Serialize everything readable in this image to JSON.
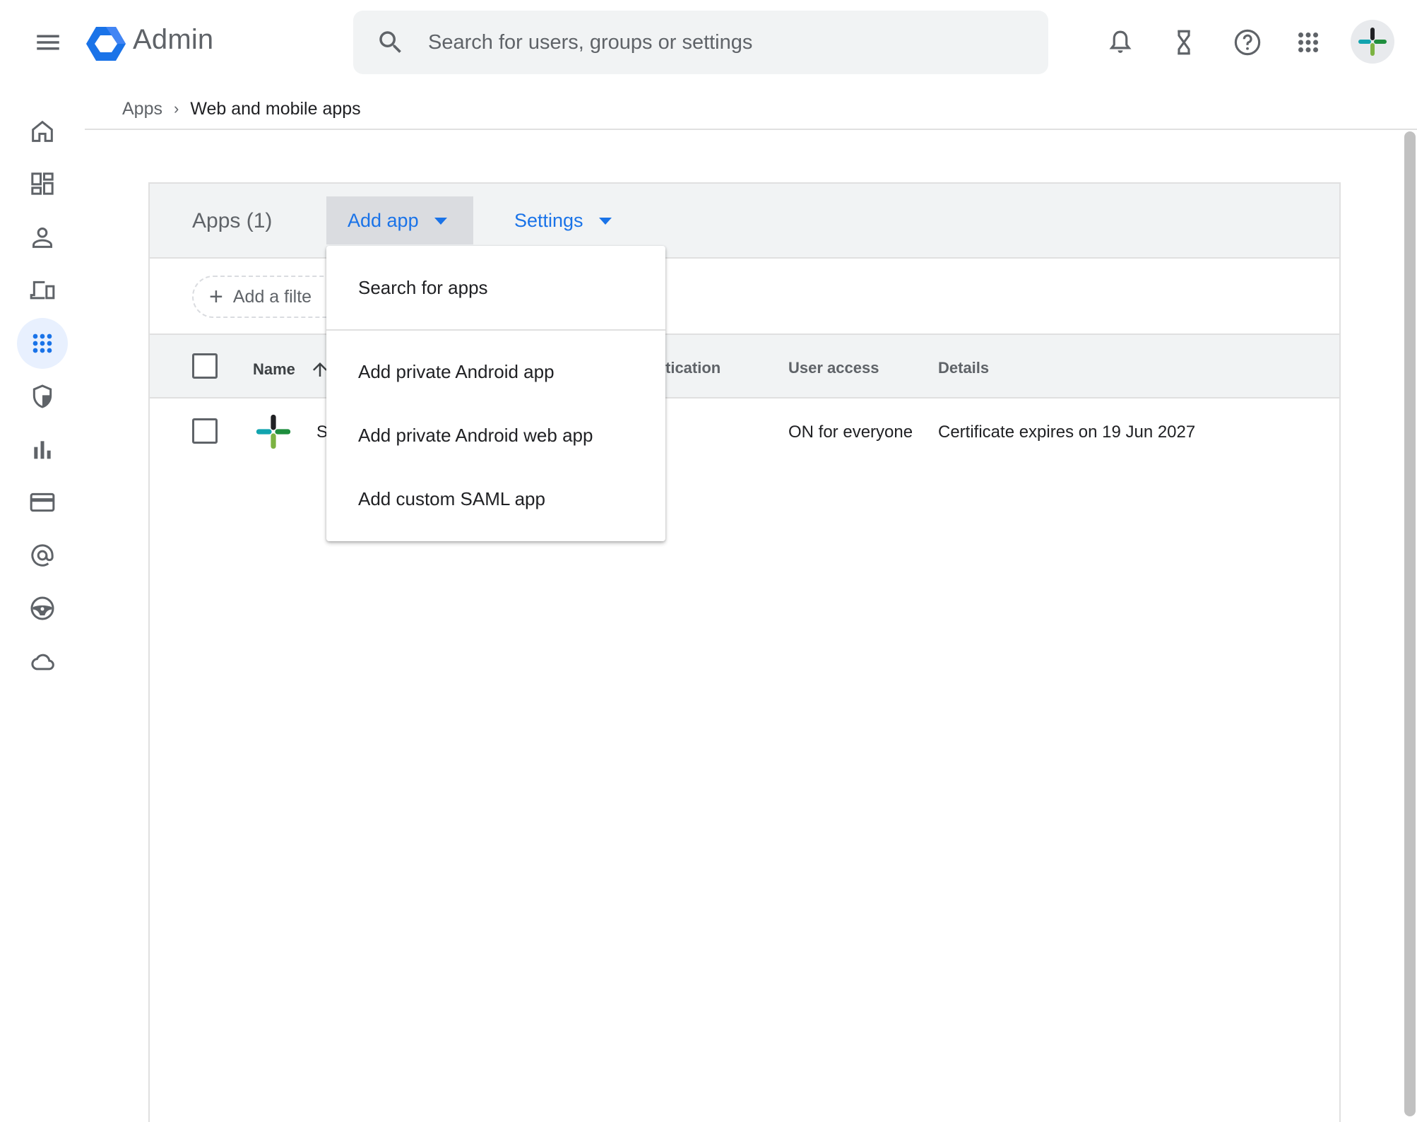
{
  "header": {
    "app_title": "Admin",
    "search_placeholder": "Search for users, groups or settings"
  },
  "breadcrumb": {
    "parent": "Apps",
    "separator": "›",
    "current": "Web and mobile apps"
  },
  "nav": {
    "items": [
      {
        "name": "home-icon",
        "active": false
      },
      {
        "name": "dashboard-icon",
        "active": false
      },
      {
        "name": "person-icon",
        "active": false
      },
      {
        "name": "devices-icon",
        "active": false
      },
      {
        "name": "apps-grid-icon",
        "active": true
      },
      {
        "name": "security-shield-icon",
        "active": false
      },
      {
        "name": "reporting-bar-chart-icon",
        "active": false
      },
      {
        "name": "billing-card-icon",
        "active": false
      },
      {
        "name": "account-at-icon",
        "active": false
      },
      {
        "name": "rules-steering-icon",
        "active": false
      },
      {
        "name": "storage-cloud-icon",
        "active": false
      }
    ]
  },
  "toolbar": {
    "apps_count": "Apps (1)",
    "add_app": "Add app",
    "settings": "Settings"
  },
  "filter": {
    "label": "Add a filte"
  },
  "table": {
    "columns": {
      "name": "Name",
      "authentication": "tication",
      "user_access": "User access",
      "details": "Details"
    },
    "rows": [
      {
        "name": "S",
        "user_access": "ON for everyone",
        "details": "Certificate expires on 19 Jun 2027"
      }
    ]
  },
  "dropdown": {
    "items": [
      "Search for apps",
      "Add private Android app",
      "Add private Android web app",
      "Add custom SAML app"
    ]
  },
  "colors": {
    "accent": "#1a73e8",
    "icon": "#5f6368",
    "header_bg": "#f1f3f4"
  }
}
